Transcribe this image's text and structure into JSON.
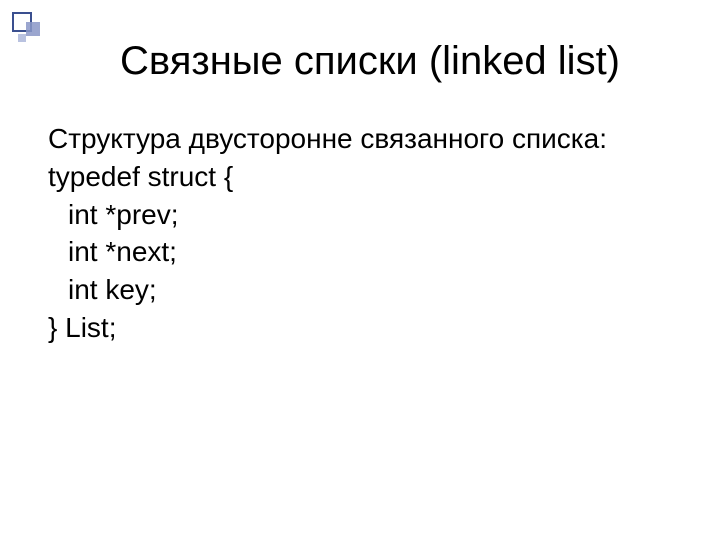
{
  "slide": {
    "title": "Связные списки (linked list)",
    "intro": "Структура двусторонне связанного списка:",
    "code": {
      "l1": "typedef struct {",
      "l2": "int *prev;",
      "l3": "int *next;",
      "l4": "int key;",
      "l5": "} List;"
    }
  }
}
